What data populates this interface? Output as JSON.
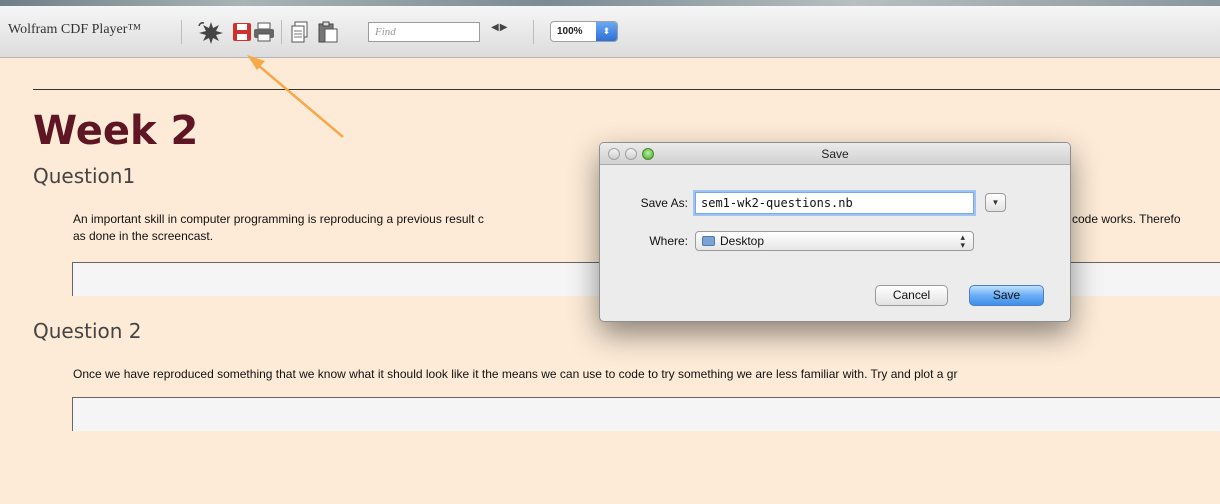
{
  "app": {
    "title": "Wolfram CDF Player™"
  },
  "toolbar": {
    "icons": [
      "new-notebook-icon",
      "save-icon",
      "print-icon",
      "copy-icon",
      "paste-icon"
    ],
    "find_placeholder": "Find",
    "nav_arrows": "◀▶",
    "zoom_value": "100%",
    "zoom_stepper": "⬍"
  },
  "document": {
    "title": "Week 2",
    "sections": [
      {
        "heading": "Question1",
        "text_line1": "An important skill in computer programming is reproducing a previous result c",
        "text_line1_tail": "code works. Therefo",
        "text_line2": "as done in the screencast."
      },
      {
        "heading": "Question 2",
        "text_line1": "Once we have reproduced something that we know what it should look like it the means we can use to code to try something we are less familiar with. Try and plot a gr"
      }
    ]
  },
  "dialog": {
    "title": "Save",
    "save_as_label": "Save As:",
    "filename": "sem1-wk2-questions.nb",
    "where_label": "Where:",
    "where_value": "Desktop",
    "cancel_label": "Cancel",
    "save_label": "Save"
  },
  "colors": {
    "page_bg": "#fdebd7",
    "title": "#5e1524",
    "annotation_arrow": "#f5a94b",
    "save_icon": "#d0312d",
    "accent_button": "#3f8ee9"
  }
}
